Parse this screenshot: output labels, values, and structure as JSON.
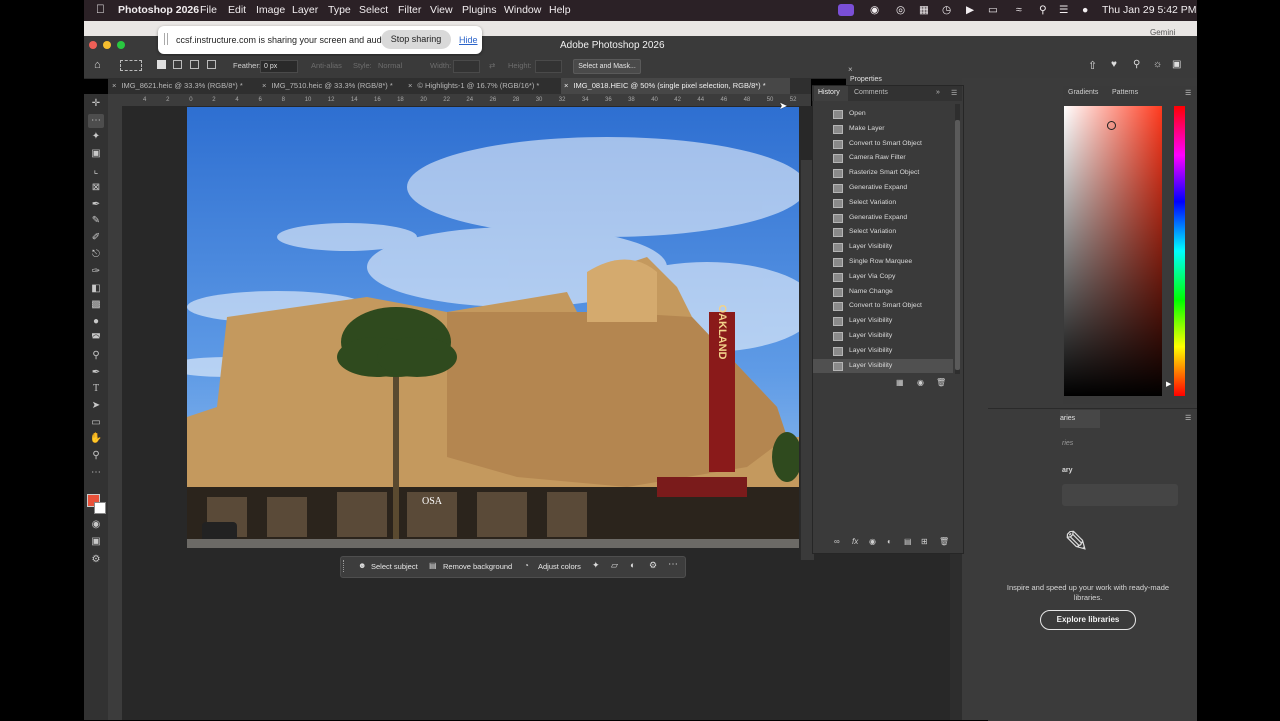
{
  "menubar": {
    "app_name": "Photoshop 2026",
    "menus": [
      "File",
      "Edit",
      "Image",
      "Layer",
      "Type",
      "Select",
      "Filter",
      "View",
      "Plugins",
      "Window",
      "Help"
    ],
    "clock": "Thu Jan 29  5:42 PM"
  },
  "window": {
    "title": "Adobe Photoshop 2026",
    "gemini_label": "Gemini"
  },
  "share_banner": {
    "text": "ccsf.instructure.com is sharing your screen and audio.",
    "stop_label": "Stop sharing",
    "hide_label": "Hide"
  },
  "options_bar": {
    "feather_label": "Feather:",
    "feather_value": "0 px",
    "anti_alias_label": "Anti-alias",
    "style_label": "Style:",
    "style_value": "Normal",
    "width_label": "Width:",
    "height_label": "Height:",
    "select_mask_label": "Select and Mask..."
  },
  "tabs": [
    {
      "label": "IMG_8621.heic @ 33.3% (RGB/8*) *",
      "active": false
    },
    {
      "label": "IMG_7510.heic @ 33.3% (RGB/8*) *",
      "active": false
    },
    {
      "label": "© Highlights-1 @ 16.7% (RGB/16*) *",
      "active": false
    },
    {
      "label": "IMG_0818.HEIC @ 50% (single pixel selection, RGB/8*) *",
      "active": true
    }
  ],
  "ruler": {
    "h_ticks": [
      "4",
      "2",
      "0",
      "2",
      "4",
      "6",
      "8",
      "10",
      "12",
      "14",
      "16",
      "18",
      "20",
      "22",
      "24",
      "26",
      "28",
      "30",
      "32",
      "34",
      "36",
      "38",
      "40",
      "42",
      "44",
      "46",
      "48",
      "50",
      "52"
    ]
  },
  "photo": {
    "sign_text": "OAKLAND",
    "store_text": "OSA"
  },
  "context_bar": {
    "select_subject": "Select subject",
    "remove_background": "Remove background",
    "adjust_colors": "Adjust colors"
  },
  "properties": {
    "title": "Properties"
  },
  "history": {
    "tab_history": "History",
    "tab_comments": "Comments",
    "items": [
      "Open",
      "Make Layer",
      "Convert to Smart Object",
      "Camera Raw Filter",
      "Rasterize Smart Object",
      "Generative Expand",
      "Select Variation",
      "Generative Expand",
      "Select Variation",
      "Layer Visibility",
      "Single Row Marquee",
      "Layer Via Copy",
      "Name Change",
      "Convert to Smart Object",
      "Layer Visibility",
      "Layer Visibility",
      "Layer Visibility",
      "Layer Visibility"
    ]
  },
  "color_panel": {
    "tab_gradients": "Gradients",
    "tab_patterns": "Patterns"
  },
  "libraries": {
    "tab_label": "aries",
    "sub_label": "ries",
    "field_label": "ary",
    "promo_text": "Inspire and speed up your work with ready-made libraries.",
    "explore_label": "Explore libraries"
  }
}
